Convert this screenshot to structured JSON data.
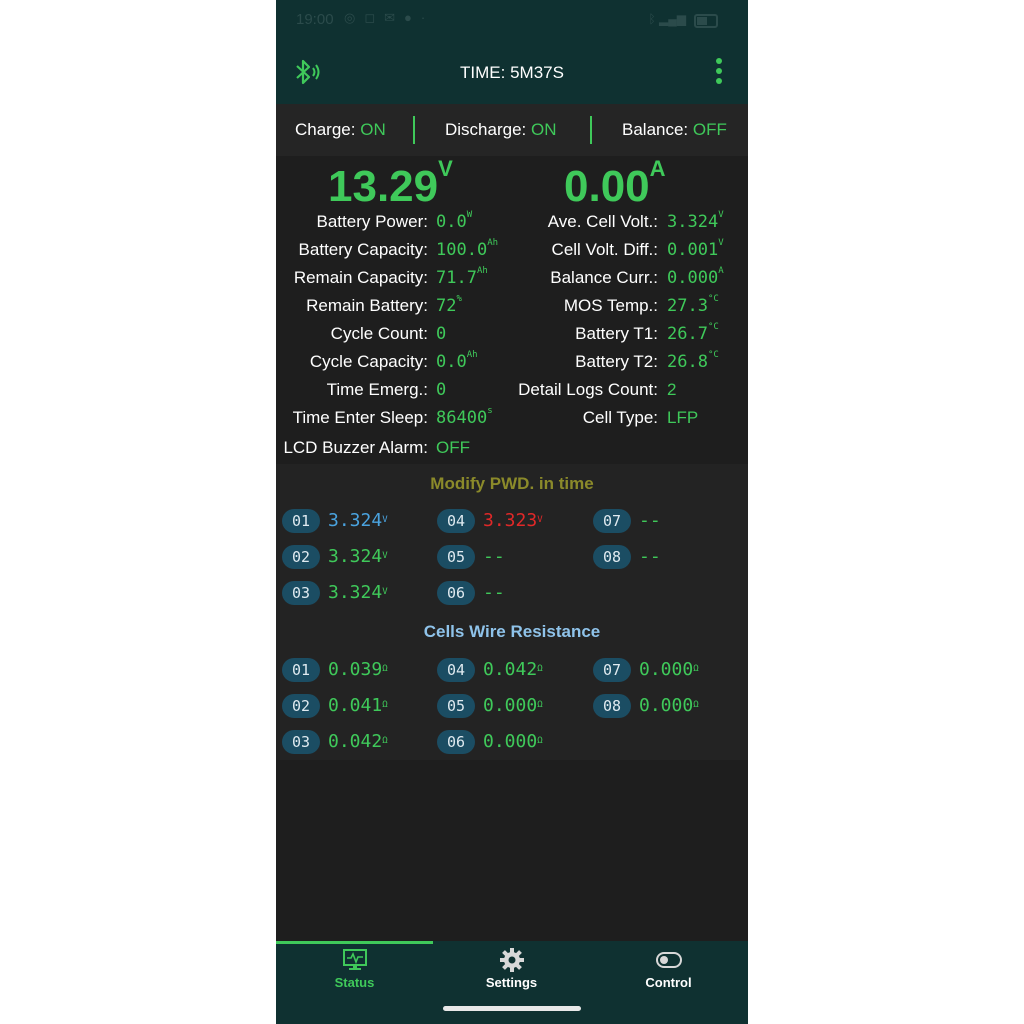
{
  "status_bar": {
    "time": "19:00",
    "icons": [
      "whatsapp-icon",
      "instagram-icon",
      "gmail-icon",
      "chat-icon",
      "dot-icon"
    ],
    "right_icons": [
      "bluetooth-icon",
      "signal-icon",
      "battery-icon"
    ]
  },
  "header": {
    "title": "TIME: 5M37S"
  },
  "switches": {
    "charge_label": "Charge:",
    "charge_value": "ON",
    "discharge_label": "Discharge:",
    "discharge_value": "ON",
    "balance_label": "Balance:",
    "balance_value": "OFF"
  },
  "main": {
    "voltage": "13.29",
    "voltage_unit": "V",
    "current": "0.00",
    "current_unit": "A",
    "left": [
      {
        "label": "Battery Power:",
        "value": "0.0",
        "unit": "W"
      },
      {
        "label": "Battery Capacity:",
        "value": "100.0",
        "unit": "Ah"
      },
      {
        "label": "Remain Capacity:",
        "value": "71.7",
        "unit": "Ah"
      },
      {
        "label": "Remain Battery:",
        "value": "72",
        "unit": "%"
      },
      {
        "label": "Cycle Count:",
        "value": "0",
        "unit": ""
      },
      {
        "label": "Cycle Capacity:",
        "value": "0.0",
        "unit": "Ah"
      },
      {
        "label": "Time Emerg.:",
        "value": "0",
        "unit": ""
      },
      {
        "label": "Time Enter Sleep:",
        "value": "86400",
        "unit": "s"
      },
      {
        "label": "LCD Buzzer Alarm:",
        "value": "OFF",
        "unit": ""
      }
    ],
    "right": [
      {
        "label": "Ave. Cell Volt.:",
        "value": "3.324",
        "unit": "V"
      },
      {
        "label": "Cell Volt. Diff.:",
        "value": "0.001",
        "unit": "V"
      },
      {
        "label": "Balance Curr.:",
        "value": "0.000",
        "unit": "A"
      },
      {
        "label": "MOS Temp.:",
        "value": "27.3",
        "unit": "°C"
      },
      {
        "label": "Battery T1:",
        "value": "26.7",
        "unit": "°C"
      },
      {
        "label": "Battery T2:",
        "value": "26.8",
        "unit": "°C"
      },
      {
        "label": "Detail Logs Count:",
        "value": "2",
        "unit": ""
      },
      {
        "label": "Cell Type:",
        "value": "LFP",
        "unit": ""
      }
    ]
  },
  "cells_voltage": {
    "title": "Modify PWD. in time",
    "title_color": "#8b8a2a",
    "cells": [
      {
        "id": "01",
        "value": "3.324",
        "unit": "V",
        "color": "#4aa3df"
      },
      {
        "id": "02",
        "value": "3.324",
        "unit": "V",
        "color": "#3fc95a"
      },
      {
        "id": "03",
        "value": "3.324",
        "unit": "V",
        "color": "#3fc95a"
      },
      {
        "id": "04",
        "value": "3.323",
        "unit": "V",
        "color": "#e02828"
      },
      {
        "id": "05",
        "value": "--",
        "unit": "",
        "color": "#3fc95a"
      },
      {
        "id": "06",
        "value": "--",
        "unit": "",
        "color": "#3fc95a"
      },
      {
        "id": "07",
        "value": "--",
        "unit": "",
        "color": "#3fc95a"
      },
      {
        "id": "08",
        "value": "--",
        "unit": "",
        "color": "#3fc95a"
      }
    ]
  },
  "cells_resistance": {
    "title": "Cells Wire Resistance",
    "title_color": "#8fc3ea",
    "cells": [
      {
        "id": "01",
        "value": "0.039",
        "unit": "Ω"
      },
      {
        "id": "02",
        "value": "0.041",
        "unit": "Ω"
      },
      {
        "id": "03",
        "value": "0.042",
        "unit": "Ω"
      },
      {
        "id": "04",
        "value": "0.042",
        "unit": "Ω"
      },
      {
        "id": "05",
        "value": "0.000",
        "unit": "Ω"
      },
      {
        "id": "06",
        "value": "0.000",
        "unit": "Ω"
      },
      {
        "id": "07",
        "value": "0.000",
        "unit": "Ω"
      },
      {
        "id": "08",
        "value": "0.000",
        "unit": "Ω"
      }
    ]
  },
  "bottom_nav": {
    "items": [
      {
        "label": "Status",
        "icon": "monitor-icon",
        "active": true
      },
      {
        "label": "Settings",
        "icon": "gear-icon",
        "active": false
      },
      {
        "label": "Control",
        "icon": "toggle-icon",
        "active": false
      }
    ]
  },
  "colors": {
    "accent": "#3fc95a",
    "header_bg": "#0f3131",
    "content_bg": "#1e1e1e",
    "badge_bg": "#1b4d63"
  }
}
